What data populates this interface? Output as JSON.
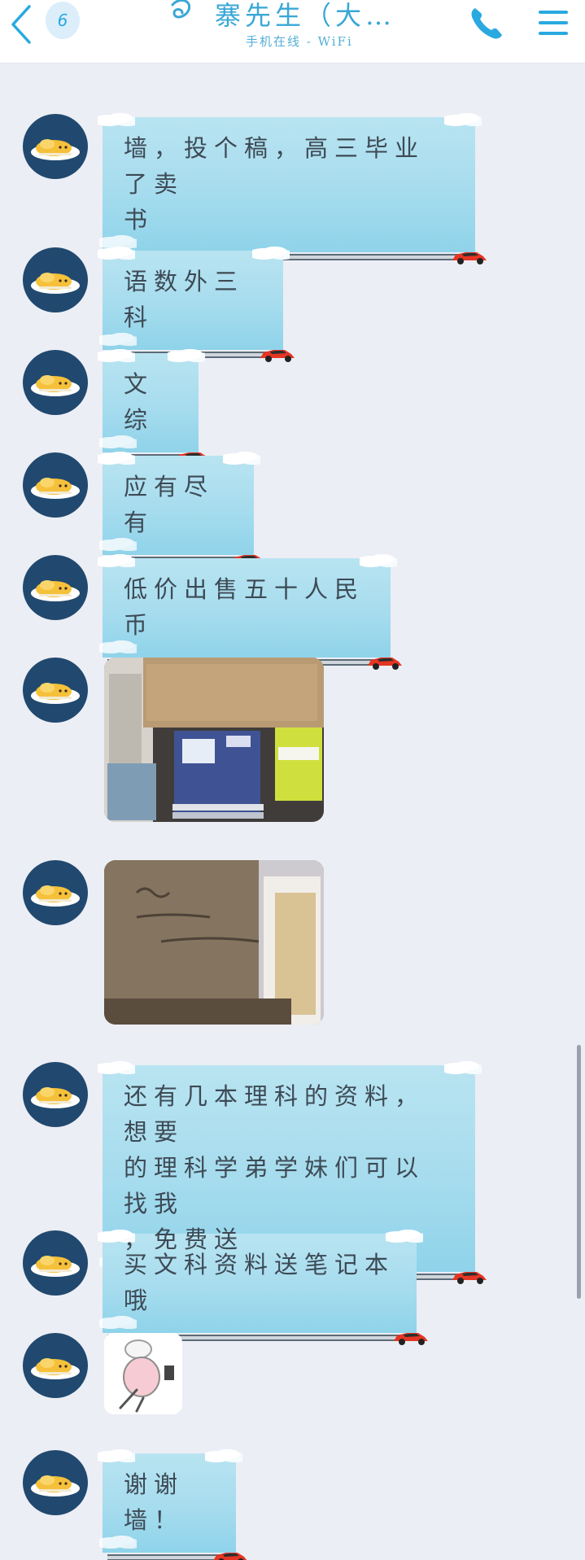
{
  "header": {
    "back_icon": "chevron-left-icon",
    "unread_count": "6",
    "contact_name": "寨先生（大…",
    "status": "手机在线 - WiFi",
    "call_icon": "phone-icon",
    "menu_icon": "hamburger-menu-icon"
  },
  "messages": [
    {
      "type": "text",
      "text": "墙，投个稿，高三毕业了卖\n书"
    },
    {
      "type": "text",
      "text": "语数外三科"
    },
    {
      "type": "text",
      "text": "文综"
    },
    {
      "type": "text",
      "text": "应有尽有"
    },
    {
      "type": "text",
      "text": "低价出售五十人民币"
    },
    {
      "type": "image",
      "description": "photo-books-in-box"
    },
    {
      "type": "image",
      "description": "photo-cardboard-box"
    },
    {
      "type": "text",
      "text": "还有几本理科的资料，想要\n的理科学弟学妹们可以找我\n，免费送"
    },
    {
      "type": "text",
      "text": "买文科资料送笔记本哦"
    },
    {
      "type": "sticker",
      "description": "sticker-cartoon"
    },
    {
      "type": "text",
      "text": "谢谢墙！"
    }
  ],
  "theme": {
    "accent": "#29a9e0",
    "bubble": "#a6dcee",
    "avatar_bg": "#21496f",
    "page_bg": "#eceef5"
  }
}
